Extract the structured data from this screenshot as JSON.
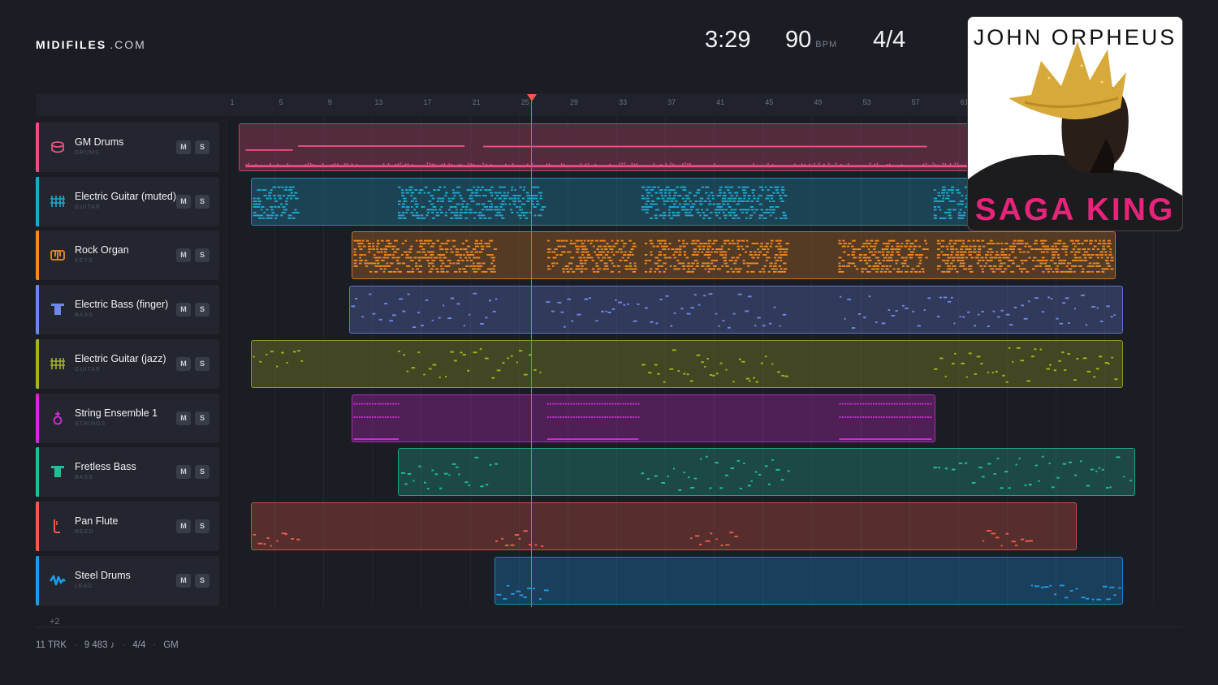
{
  "brand": {
    "name_bold": "MIDIFILES",
    "name_light": ".COM"
  },
  "transport": {
    "time": "3:29",
    "tempo": "90",
    "tempo_unit": "BPM",
    "signature": "4/4"
  },
  "ruler": {
    "bars": [
      "1",
      "5",
      "9",
      "13",
      "17",
      "21",
      "25",
      "29",
      "33",
      "37",
      "41",
      "45",
      "49",
      "53",
      "57",
      "61"
    ]
  },
  "playhead": {
    "bar": 25.2
  },
  "tracks": [
    {
      "name": "GM Drums",
      "category": "DRUMS",
      "color": "#e8507f",
      "icon": "drum-icon",
      "mute": "M",
      "solo": "S"
    },
    {
      "name": "Electric Guitar (muted)",
      "category": "GUITAR",
      "color": "#1fa8cf",
      "icon": "guitar-fretboard-icon",
      "mute": "M",
      "solo": "S"
    },
    {
      "name": "Rock Organ",
      "category": "KEYS",
      "color": "#ec8a24",
      "icon": "keyboard-icon",
      "mute": "M",
      "solo": "S"
    },
    {
      "name": "Electric Bass (finger)",
      "category": "BASS",
      "color": "#6f88e8",
      "icon": "bass-icon",
      "mute": "M",
      "solo": "S"
    },
    {
      "name": "Electric Guitar (jazz)",
      "category": "GUITAR",
      "color": "#a8b31c",
      "icon": "guitar-fretboard-icon",
      "mute": "M",
      "solo": "S"
    },
    {
      "name": "String Ensemble 1",
      "category": "STRINGS",
      "color": "#d42ad8",
      "icon": "violin-icon",
      "mute": "M",
      "solo": "S"
    },
    {
      "name": "Fretless Bass",
      "category": "BASS",
      "color": "#1fbf9a",
      "icon": "bass-icon",
      "mute": "M",
      "solo": "S"
    },
    {
      "name": "Pan Flute",
      "category": "REED",
      "color": "#ef5c48",
      "icon": "flute-icon",
      "mute": "M",
      "solo": "S"
    },
    {
      "name": "Steel Drums",
      "category": "LEAD",
      "color": "#1d9be6",
      "icon": "waveform-icon",
      "mute": "M",
      "solo": "S"
    }
  ],
  "more_tracks": "+2",
  "footer": {
    "tracks": "11 TRK",
    "notes": "9 483 ♪",
    "signature": "4/4",
    "standard": "GM"
  },
  "album": {
    "artist": "JOHN ORPHEUS",
    "title": "SAGA KING"
  }
}
